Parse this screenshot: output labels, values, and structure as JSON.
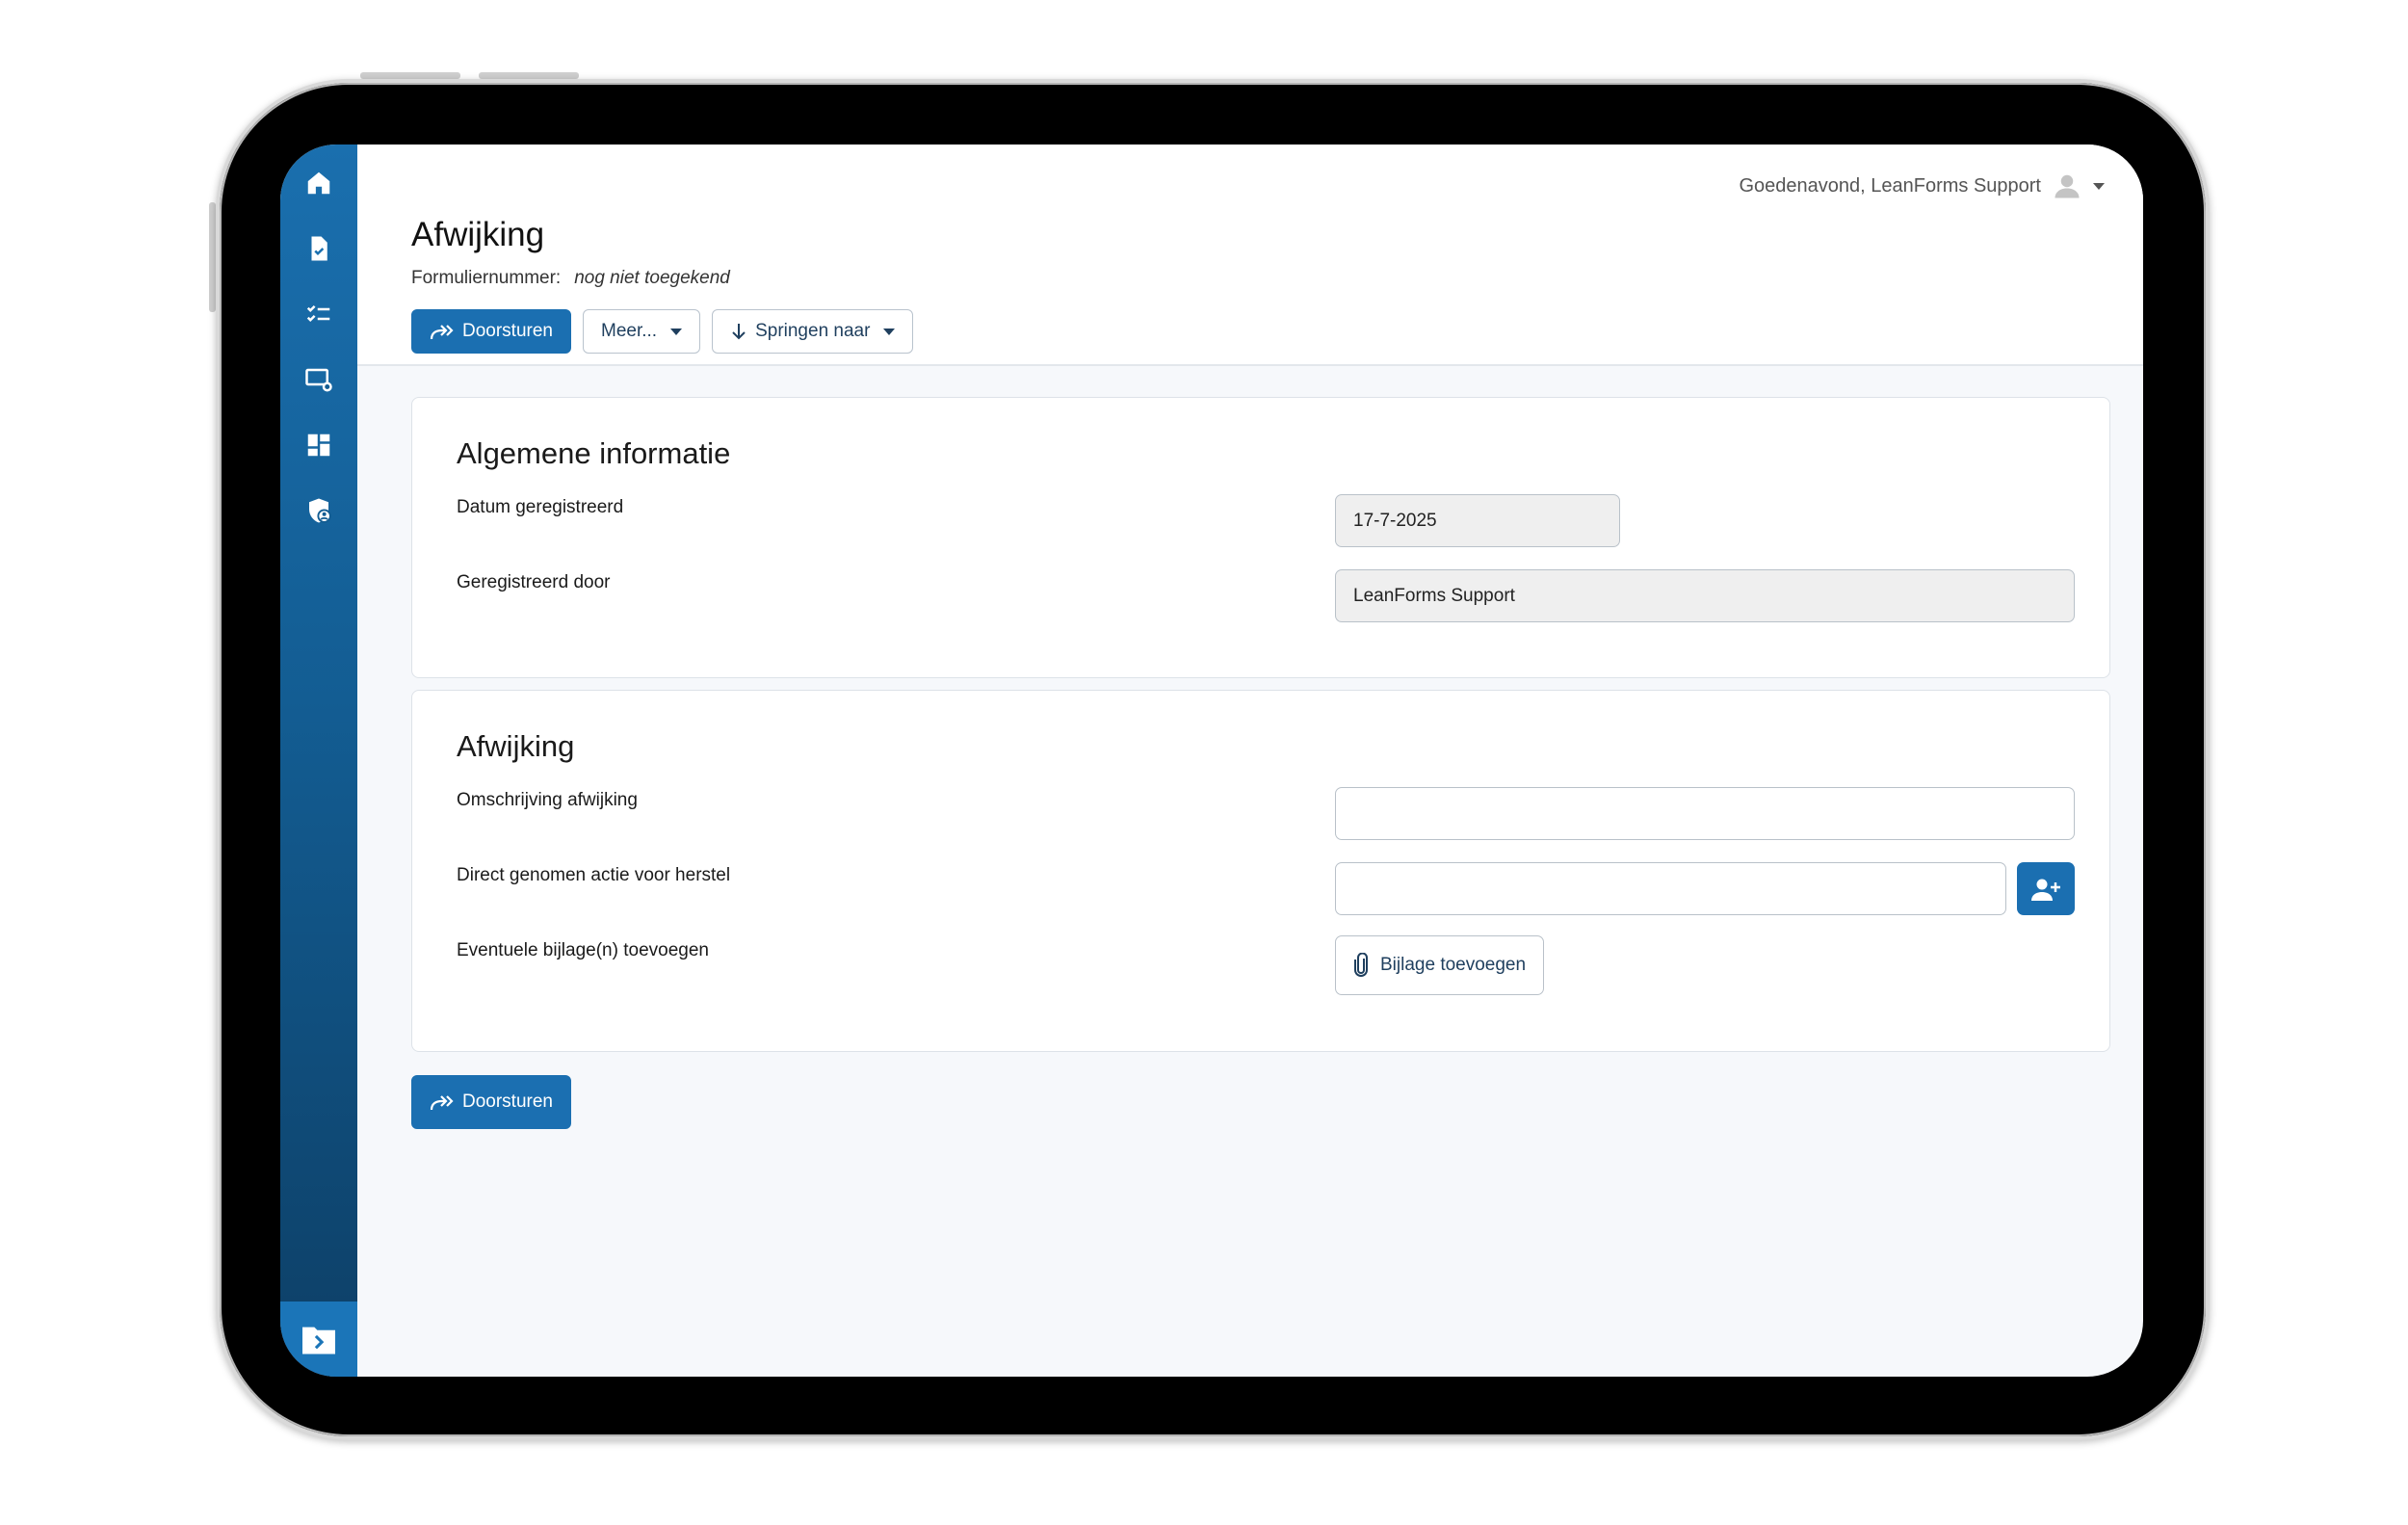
{
  "header": {
    "greeting": "Goedenavond, LeanForms Support",
    "title": "Afwijking",
    "form_number_label": "Formuliernummer:",
    "form_number_value": "nog niet toegekend",
    "buttons": {
      "forward": "Doorsturen",
      "more": "Meer...",
      "jump": "Springen naar"
    }
  },
  "sidebar": {
    "items": [
      "home-icon",
      "document-check-icon",
      "checklist-icon",
      "screen-settings-icon",
      "dashboard-icon",
      "shield-user-icon"
    ],
    "bottom": "folder-chevron-icon"
  },
  "sections": {
    "general": {
      "title": "Algemene informatie",
      "date_label": "Datum geregistreerd",
      "date_value": "17-7-2025",
      "registered_by_label": "Geregistreerd door",
      "registered_by_value": "LeanForms Support"
    },
    "deviation": {
      "title": "Afwijking",
      "description_label": "Omschrijving afwijking",
      "description_value": "",
      "action_label": "Direct genomen actie voor herstel",
      "action_value": "",
      "attachment_label": "Eventuele bijlage(n) toevoegen",
      "attachment_button": "Bijlage toevoegen"
    }
  },
  "footer": {
    "forward": "Doorsturen"
  },
  "colors": {
    "primary": "#1b6fb1",
    "sidebar_top": "#1a6fae",
    "sidebar_bottom": "#0d3f66"
  }
}
